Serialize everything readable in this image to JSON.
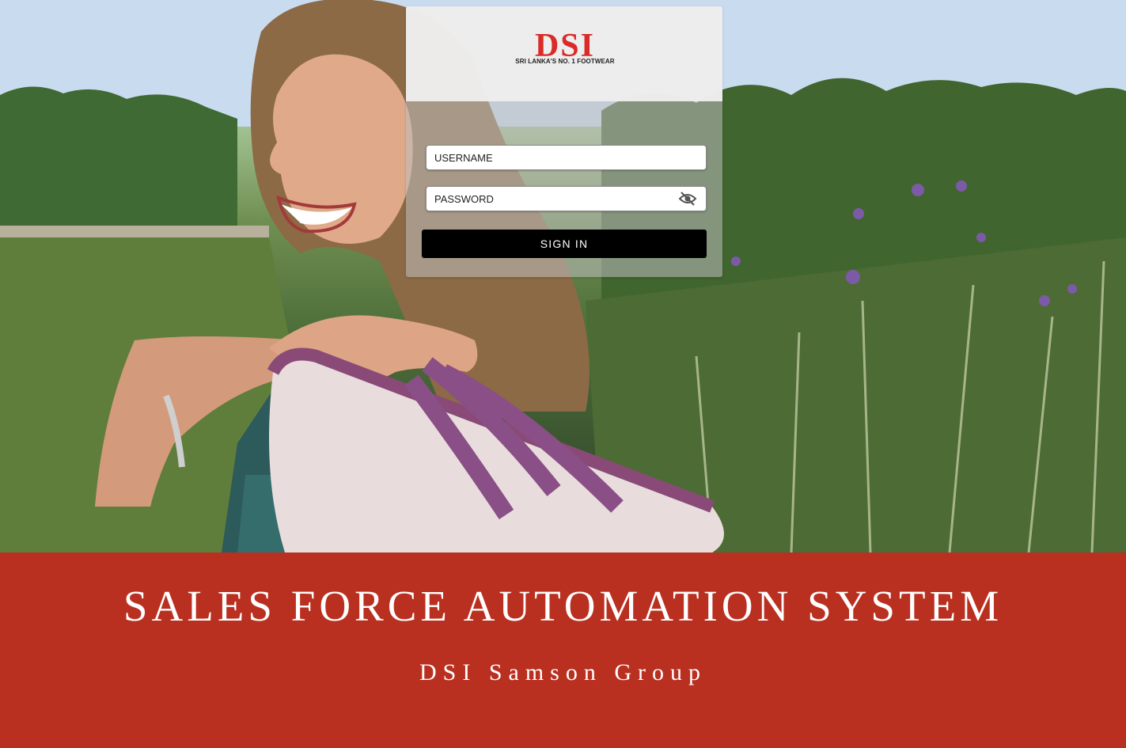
{
  "brand": {
    "logo_text": "DSI",
    "logo_tagline": "SRI LANKA'S NO. 1 FOOTWEAR",
    "logo_color": "#d92b27"
  },
  "login": {
    "username_placeholder": "USERNAME",
    "password_placeholder": "PASSWORD",
    "password_toggle_icon": "eye-off-icon",
    "signin_label": "SIGN IN"
  },
  "footer": {
    "title": "SALES FORCE AUTOMATION SYSTEM",
    "subtitle": "DSI Samson Group",
    "background_color": "#b93020"
  }
}
